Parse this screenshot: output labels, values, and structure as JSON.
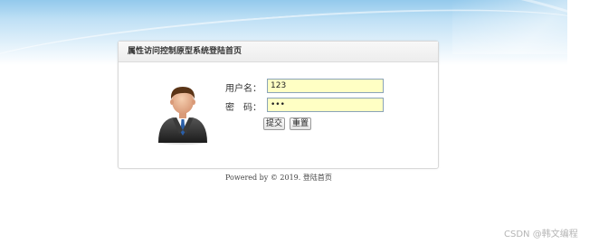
{
  "panel": {
    "title": "属性访问控制原型系统登陆首页"
  },
  "form": {
    "username_label": "用户名：",
    "username_value": "123",
    "password_label": "密　码：",
    "password_value": "123",
    "submit_label": "提交",
    "reset_label": "重置"
  },
  "footer": {
    "text": "Powered by © 2019.",
    "link": "登陆首页"
  },
  "watermark": "CSDN @韩文编程",
  "icons": {
    "avatar": "businessman-avatar-icon"
  }
}
